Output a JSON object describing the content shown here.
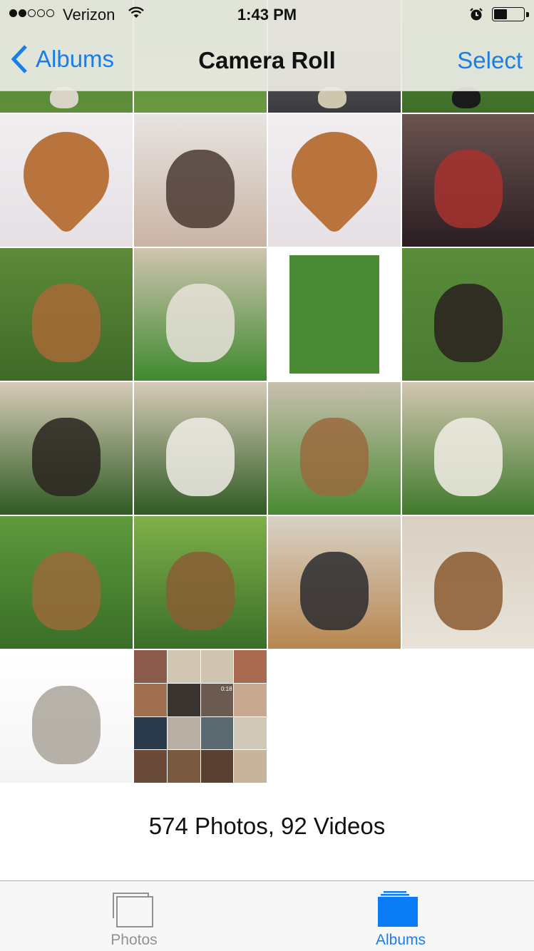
{
  "status_bar": {
    "signal_bars_filled": 2,
    "signal_bars_total": 5,
    "carrier": "Verizon",
    "wifi_icon": "wifi-icon",
    "time": "1:43 PM",
    "alarm_icon": "alarm-clock-icon",
    "battery_level": 0.45
  },
  "nav_bar": {
    "back_label": "Albums",
    "back_icon": "chevron-left-icon",
    "title": "Camera Roll",
    "select_label": "Select"
  },
  "colors": {
    "accent": "#1a7ee8",
    "tab_inactive": "#929292",
    "tab_active_icon": "#0a7cf5",
    "text": "#111111"
  },
  "photos": [
    {
      "desc": "grass partial",
      "colors": [
        "#4a7a32",
        "#5f8f3a"
      ],
      "subject": "#d8d4c8"
    },
    {
      "desc": "grass partial",
      "colors": [
        "#4f8234",
        "#6a9a40"
      ],
      "subject": null
    },
    {
      "desc": "dog partial",
      "colors": [
        "#8a8270",
        "#3a3a40"
      ],
      "subject": "#cfc6b0"
    },
    {
      "desc": "grass partial",
      "colors": [
        "#5a8a34",
        "#3f6e2a"
      ],
      "subject": "#1a1a1a"
    },
    {
      "desc": "dogs heart collage",
      "colors": [
        "#f1eef0",
        "#e6e0e4"
      ],
      "subject": "#b8743c",
      "shape": "heart"
    },
    {
      "desc": "woman selfie",
      "colors": [
        "#e8e4e2",
        "#c9b4a4"
      ],
      "subject": "#4a3a32"
    },
    {
      "desc": "dogs heart collage",
      "colors": [
        "#f1eef0",
        "#e6e0e4"
      ],
      "subject": "#b8743c",
      "shape": "heart"
    },
    {
      "desc": "family photo",
      "colors": [
        "#6b5450",
        "#2a1e22"
      ],
      "subject": "#a8322e"
    },
    {
      "desc": "dog rolling on grass",
      "colors": [
        "#5e8a3a",
        "#3f6a28"
      ],
      "subject": "#a86a36"
    },
    {
      "desc": "dog smiling on lawn",
      "colors": [
        "#cfc4b0",
        "#3f8a2e"
      ],
      "subject": "#e8e2da"
    },
    {
      "desc": "dog framed photo",
      "colors": [
        "#ffffff",
        "#ffffff"
      ],
      "subject": "#4b8a34",
      "framed": true
    },
    {
      "desc": "dog lying on grass",
      "colors": [
        "#5a8c3c",
        "#4a7a30"
      ],
      "subject": "#2a2020"
    },
    {
      "desc": "dog lying in yard",
      "colors": [
        "#d6cbb8",
        "#2f5a22"
      ],
      "subject": "#2a2420"
    },
    {
      "desc": "dog lying in yard",
      "colors": [
        "#d6cbb8",
        "#2f5a22"
      ],
      "subject": "#f0ece6"
    },
    {
      "desc": "dog closeup",
      "colors": [
        "#c8c0ae",
        "#4a8a32"
      ],
      "subject": "#9a6a3e"
    },
    {
      "desc": "dog tongue out",
      "colors": [
        "#d2c6b0",
        "#3f7a2c"
      ],
      "subject": "#f2ede6"
    },
    {
      "desc": "dog on lawn",
      "colors": [
        "#5e9a3c",
        "#3a6e28"
      ],
      "subject": "#9a6a3a"
    },
    {
      "desc": "dog on lawn tongue",
      "colors": [
        "#7fb04a",
        "#3a6e28"
      ],
      "subject": "#8a5e34"
    },
    {
      "desc": "girl with dog indoor",
      "colors": [
        "#d8d2c6",
        "#b88650"
      ],
      "subject": "#2c2c30"
    },
    {
      "desc": "dog with bowl",
      "colors": [
        "#d9cfc2",
        "#e8e2d8"
      ],
      "subject": "#8a5a30"
    },
    {
      "desc": "gray sneaker",
      "colors": [
        "#ffffff",
        "#f4f4f4"
      ],
      "subject": "#a9a49a"
    },
    {
      "desc": "video mosaic",
      "mosaic": [
        "#8a5a4a",
        "#d0c6b2",
        "#cfc4b0",
        "#a86a50",
        "#a07050",
        "#3a3430",
        "#6a5a50",
        "#c8a890",
        "#2a3a4a",
        "#b8b0a4",
        "#5a6a70",
        "#d0c8b8",
        "#6a4a38",
        "#7a5a40",
        "#5a4030",
        "#c8b49a"
      ],
      "duration": "0:18"
    }
  ],
  "footer": {
    "count_text": "574 Photos, 92 Videos"
  },
  "tab_bar": {
    "tabs": [
      {
        "label": "Photos",
        "icon": "photos-stack-icon",
        "active": false
      },
      {
        "label": "Albums",
        "icon": "albums-icon",
        "active": true
      }
    ]
  }
}
